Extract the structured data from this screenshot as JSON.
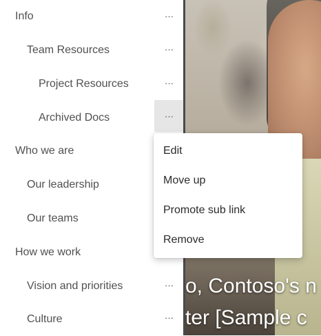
{
  "nav": {
    "items": [
      {
        "label": "Info",
        "level": 1,
        "has_more": true
      },
      {
        "label": "Team Resources",
        "level": 2,
        "has_more": true
      },
      {
        "label": "Project Resources",
        "level": 3,
        "has_more": true
      },
      {
        "label": "Archived Docs",
        "level": 3,
        "has_more": true,
        "active": true
      },
      {
        "label": "Who we are",
        "level": 1,
        "has_more": false
      },
      {
        "label": "Our leadership",
        "level": 2,
        "has_more": false
      },
      {
        "label": "Our teams",
        "level": 2,
        "has_more": false
      },
      {
        "label": "How we work",
        "level": 1,
        "has_more": false
      },
      {
        "label": "Vision and priorities",
        "level": 2,
        "has_more": true
      },
      {
        "label": "Culture",
        "level": 2,
        "has_more": true
      }
    ],
    "more_glyph": "···"
  },
  "context_menu": {
    "items": [
      "Edit",
      "Move up",
      "Promote sub link",
      "Remove"
    ]
  },
  "hero": {
    "line1": "o, Contoso's n",
    "line2": "ter [Sample c"
  }
}
